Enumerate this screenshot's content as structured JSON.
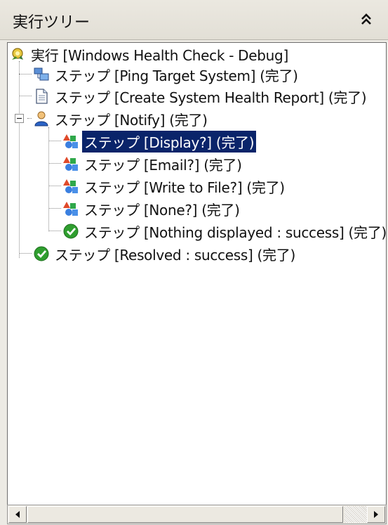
{
  "panel": {
    "title": "実行ツリー"
  },
  "tree": {
    "root": {
      "label": "実行 [Windows Health Check - Debug]",
      "icon": "gear-run-icon"
    },
    "steps": [
      {
        "label": "ステップ [Ping Target System] (完了)",
        "icon": "network-computer-icon"
      },
      {
        "label": "ステップ [Create System Health Report] (完了)",
        "icon": "document-icon"
      },
      {
        "label": "ステップ [Notify] (完了)",
        "icon": "user-icon",
        "expanded": true,
        "children": [
          {
            "label": "ステップ [Display?] (完了)",
            "icon": "decision-shapes-icon",
            "selected": true
          },
          {
            "label": "ステップ [Email?] (完了)",
            "icon": "decision-shapes-icon"
          },
          {
            "label": "ステップ [Write to File?] (完了)",
            "icon": "decision-shapes-icon"
          },
          {
            "label": "ステップ [None?] (完了)",
            "icon": "decision-shapes-icon"
          },
          {
            "label": "ステップ [Nothing displayed : success] (完了)",
            "icon": "check-success-icon"
          }
        ]
      },
      {
        "label": "ステップ [Resolved : success] (完了)",
        "icon": "check-success-icon"
      }
    ]
  },
  "colors": {
    "selection_bg": "#0a246a",
    "selection_fg": "#ffffff",
    "success_green": "#2f9e2f"
  }
}
